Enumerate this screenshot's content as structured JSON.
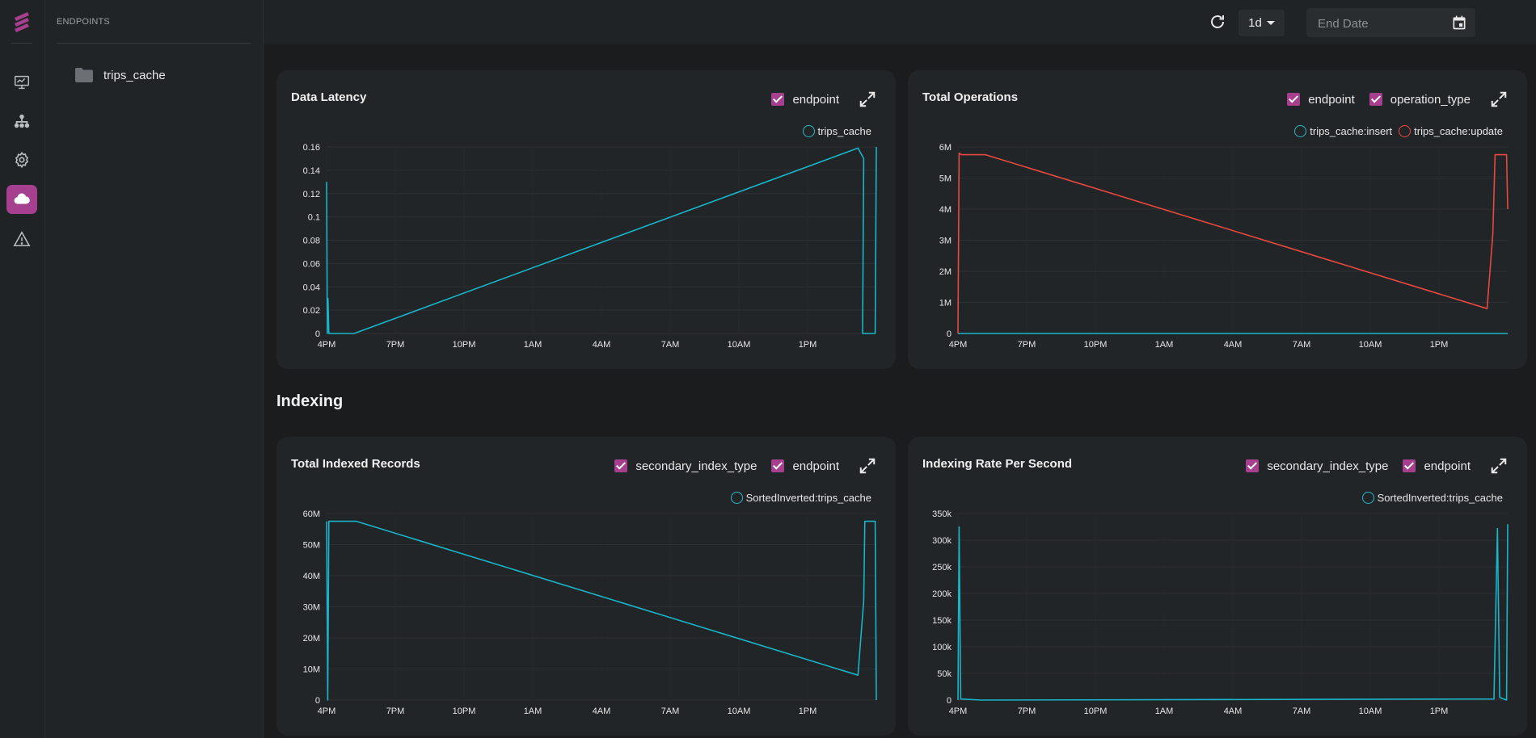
{
  "sidebar": {
    "nav": [
      {
        "name": "dashboard-icon",
        "active": false
      },
      {
        "name": "hierarchy-icon",
        "active": false
      },
      {
        "name": "settings-icon",
        "active": false
      },
      {
        "name": "cloud-icon",
        "active": true
      },
      {
        "name": "warning-icon",
        "active": false
      }
    ]
  },
  "endpoints": {
    "heading": "ENDPOINTS",
    "items": [
      {
        "label": "trips_cache",
        "icon": "folder-icon"
      }
    ]
  },
  "toolbar": {
    "range_label": "1d",
    "date_placeholder": "End Date",
    "icons": [
      "refresh-icon",
      "calendar-icon"
    ]
  },
  "colors": {
    "accent": "#a53f8e",
    "series_cyan": "#19b4c8",
    "series_red": "#e8483d"
  },
  "cards": [
    {
      "title": "Data Latency",
      "filters": [
        "endpoint"
      ],
      "legend": [
        {
          "label": "trips_cache",
          "color": "#19b4c8"
        }
      ]
    },
    {
      "title": "Total Operations",
      "filters": [
        "endpoint",
        "operation_type"
      ],
      "legend": [
        {
          "label": "trips_cache:insert",
          "color": "#19b4c8"
        },
        {
          "label": "trips_cache:update",
          "color": "#e8483d"
        }
      ]
    },
    {
      "title": "Total Indexed Records",
      "filters": [
        "secondary_index_type",
        "endpoint"
      ],
      "legend": [
        {
          "label": "SortedInverted:trips_cache",
          "color": "#19b4c8"
        }
      ]
    },
    {
      "title": "Indexing Rate Per Second",
      "filters": [
        "secondary_index_type",
        "endpoint"
      ],
      "legend": [
        {
          "label": "SortedInverted:trips_cache",
          "color": "#19b4c8"
        }
      ]
    }
  ],
  "section": {
    "indexing_title": "Indexing"
  },
  "chart_data": [
    {
      "type": "line",
      "title": "Data Latency",
      "x_ticks": [
        "4PM",
        "7PM",
        "10PM",
        "1AM",
        "4AM",
        "7AM",
        "10AM",
        "1PM"
      ],
      "y_ticks": [
        "0",
        "0.02",
        "0.04",
        "0.06",
        "0.08",
        "0.1",
        "0.12",
        "0.14",
        "0.16"
      ],
      "ylim": [
        0,
        0.16
      ],
      "xlim": [
        0,
        24
      ],
      "grid": true,
      "series": [
        {
          "name": "trips_cache",
          "color": "#19b4c8",
          "points": [
            [
              0,
              0.13
            ],
            [
              0.03,
              0
            ],
            [
              0.06,
              0.03
            ],
            [
              0.1,
              0
            ],
            [
              1.2,
              0
            ],
            [
              23.2,
              0.159
            ],
            [
              23.45,
              0.15
            ],
            [
              23.4,
              0
            ],
            [
              23.95,
              0
            ],
            [
              24,
              0.16
            ]
          ]
        }
      ]
    },
    {
      "type": "line",
      "title": "Total Operations",
      "x_ticks": [
        "4PM",
        "7PM",
        "10PM",
        "1AM",
        "4AM",
        "7AM",
        "10AM",
        "1PM"
      ],
      "y_ticks": [
        "0",
        "1M",
        "2M",
        "3M",
        "4M",
        "5M",
        "6M"
      ],
      "ylim": [
        0,
        6000000
      ],
      "xlim": [
        0,
        24
      ],
      "grid": true,
      "series": [
        {
          "name": "trips_cache:insert",
          "color": "#19b4c8",
          "points": [
            [
              0,
              0
            ],
            [
              24,
              0
            ]
          ]
        },
        {
          "name": "trips_cache:update",
          "color": "#e8483d",
          "points": [
            [
              0,
              0
            ],
            [
              0.05,
              5.8
            ],
            [
              0.15,
              5.75
            ],
            [
              1.2,
              5.75
            ],
            [
              23.1,
              0.8
            ],
            [
              23.35,
              3.2
            ],
            [
              23.45,
              5.75
            ],
            [
              23.95,
              5.75
            ],
            [
              24,
              4.0
            ]
          ]
        }
      ]
    },
    {
      "type": "line",
      "title": "Total Indexed Records",
      "x_ticks": [
        "4PM",
        "7PM",
        "10PM",
        "1AM",
        "4AM",
        "7AM",
        "10AM",
        "1PM"
      ],
      "y_ticks": [
        "0",
        "10M",
        "20M",
        "30M",
        "40M",
        "50M",
        "60M"
      ],
      "ylim": [
        0,
        60000000
      ],
      "xlim": [
        0,
        24
      ],
      "grid": true,
      "series": [
        {
          "name": "SortedInverted:trips_cache",
          "color": "#19b4c8",
          "points": [
            [
              0,
              57.5
            ],
            [
              0.05,
              0
            ],
            [
              0.1,
              57.5
            ],
            [
              1.3,
              57.5
            ],
            [
              23.2,
              8
            ],
            [
              23.45,
              32
            ],
            [
              23.5,
              57.5
            ],
            [
              23.95,
              57.5
            ],
            [
              24,
              0
            ]
          ]
        }
      ]
    },
    {
      "type": "line",
      "title": "Indexing Rate Per Second",
      "x_ticks": [
        "4PM",
        "7PM",
        "10PM",
        "1AM",
        "4AM",
        "7AM",
        "10AM",
        "1PM"
      ],
      "y_ticks": [
        "0",
        "50k",
        "100k",
        "150k",
        "200k",
        "250k",
        "300k",
        "350k"
      ],
      "ylim": [
        0,
        350000
      ],
      "xlim": [
        0,
        24
      ],
      "grid": true,
      "series": [
        {
          "name": "SortedInverted:trips_cache",
          "color": "#19b4c8",
          "points": [
            [
              0,
              0
            ],
            [
              0.05,
              325
            ],
            [
              0.12,
              2
            ],
            [
              1.0,
              0
            ],
            [
              23.4,
              2
            ],
            [
              23.55,
              322
            ],
            [
              23.65,
              5
            ],
            [
              23.95,
              0
            ],
            [
              24,
              330
            ]
          ]
        }
      ]
    }
  ]
}
